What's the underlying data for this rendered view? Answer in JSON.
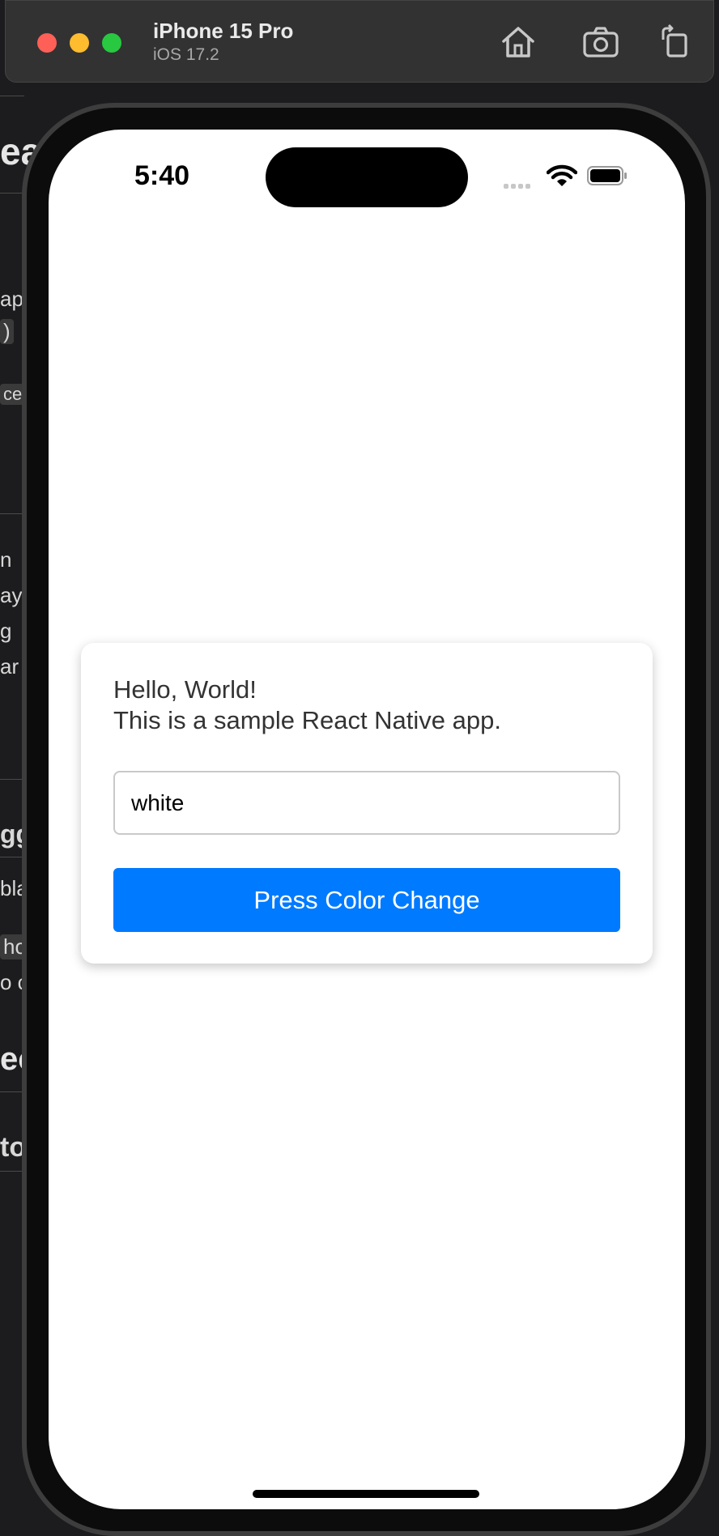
{
  "simulator": {
    "device_name": "iPhone 15 Pro",
    "os_version": "iOS 17.2",
    "toolbar_icons": [
      "home-icon",
      "screenshot-icon",
      "rotate-icon"
    ]
  },
  "background_editor": {
    "fragments": [
      "eac",
      "ap",
      ")",
      "ce",
      "n",
      "ay",
      "g",
      "ar",
      "gg",
      "bla",
      "hol",
      "o c",
      "ec",
      "to"
    ]
  },
  "status_bar": {
    "time": "5:40",
    "icons": [
      "cellular-signal-icon",
      "wifi-icon",
      "battery-icon"
    ]
  },
  "app": {
    "greeting": "Hello, World!",
    "description": "This is a sample React Native app.",
    "color_input": {
      "value": "white",
      "placeholder": ""
    },
    "button_label": "Press Color Change",
    "colors": {
      "button": "#007aff",
      "card": "#ffffff",
      "screen": "#ffffff"
    }
  }
}
